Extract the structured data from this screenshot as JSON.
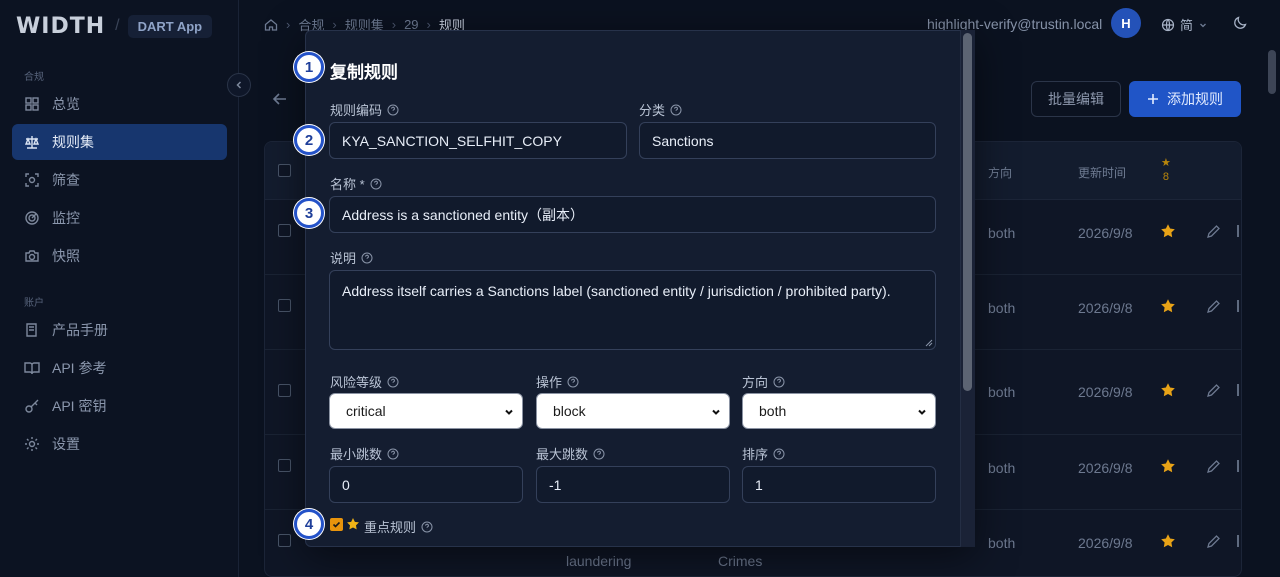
{
  "brand": {
    "logo": "WIDTH",
    "badge": "DART App"
  },
  "sidebar": {
    "section_compliance": "合规",
    "section_account": "账户",
    "items": [
      {
        "label": "总览",
        "icon": "dashboard-icon"
      },
      {
        "label": "规则集",
        "icon": "scale-icon"
      },
      {
        "label": "筛查",
        "icon": "scan-icon"
      },
      {
        "label": "监控",
        "icon": "radar-icon"
      },
      {
        "label": "快照",
        "icon": "camera-icon"
      },
      {
        "label": "产品手册",
        "icon": "book-icon"
      },
      {
        "label": "API 参考",
        "icon": "open-book-icon"
      },
      {
        "label": "API 密钥",
        "icon": "key-icon"
      },
      {
        "label": "设置",
        "icon": "gear-icon"
      }
    ]
  },
  "header": {
    "breadcrumb": [
      "合规",
      "规则集",
      "29",
      "规则"
    ],
    "user_email": "highlight-verify@trustin.local",
    "avatar_initial": "H",
    "language": "简"
  },
  "page": {
    "batch_edit_label": "批量编辑",
    "add_rule_label": "添加规则",
    "table_headers": {
      "direction": "方向",
      "updated": "更新时间",
      "star_count": "8"
    },
    "rows": [
      {
        "direction": "both",
        "updated": "2026/9/8"
      },
      {
        "direction": "both",
        "updated": "2026/9/8"
      },
      {
        "direction": "both",
        "updated": "2026/9/8"
      },
      {
        "direction": "both",
        "updated": "2026/9/8"
      },
      {
        "direction": "both",
        "updated": "2026/9/8"
      }
    ],
    "peek_cells": [
      "laundering",
      "Crimes"
    ]
  },
  "modal": {
    "title": "复制规则",
    "code_label": "规则编码",
    "code_value": "KYA_SANCTION_SELFHIT_COPY",
    "category_label": "分类",
    "category_value": "Sanctions",
    "name_label": "名称 *",
    "name_value": "Address is a sanctioned entity（副本）",
    "desc_label": "说明",
    "desc_value": "Address itself carries a Sanctions label (sanctioned entity / jurisdiction / prohibited party).",
    "risk_label": "风险等级",
    "risk_value": "critical",
    "action_label": "操作",
    "action_value": "block",
    "direction_label": "方向",
    "direction_value": "both",
    "min_hops_label": "最小跳数",
    "min_hops_value": "0",
    "max_hops_label": "最大跳数",
    "max_hops_value": "-1",
    "sort_label": "排序",
    "sort_value": "1",
    "key_rule_label": "重点规则",
    "key_rule_checked": true
  },
  "steps": [
    "1",
    "2",
    "3",
    "4"
  ],
  "colors": {
    "accent": "#2055c7",
    "active_nav": "#17366e",
    "star": "#e8a317",
    "step_border": "#2452c8"
  }
}
